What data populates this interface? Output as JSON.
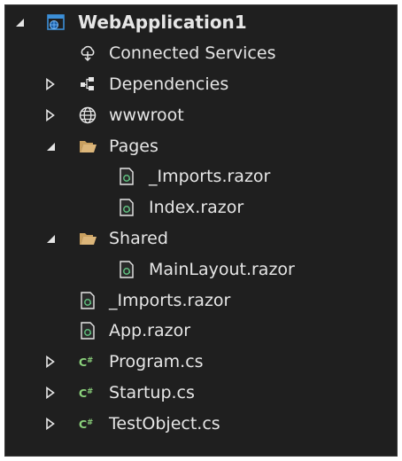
{
  "solution_explorer": {
    "root": {
      "label": "WebApplication1",
      "icon": "web-project-icon",
      "expanded": true
    },
    "items": [
      {
        "label": "Connected Services",
        "icon": "connected-services-icon"
      },
      {
        "label": "Dependencies",
        "icon": "dependencies-icon",
        "expanded": false
      },
      {
        "label": "wwwroot",
        "icon": "globe-icon",
        "expanded": false
      },
      {
        "label": "Pages",
        "icon": "folder-open-icon",
        "expanded": true,
        "children": [
          {
            "label": "_Imports.razor",
            "icon": "razor-file-icon"
          },
          {
            "label": "Index.razor",
            "icon": "razor-file-icon"
          }
        ]
      },
      {
        "label": "Shared",
        "icon": "folder-open-icon",
        "expanded": true,
        "children": [
          {
            "label": "MainLayout.razor",
            "icon": "razor-file-icon"
          }
        ]
      },
      {
        "label": "_Imports.razor",
        "icon": "razor-file-icon"
      },
      {
        "label": "App.razor",
        "icon": "razor-file-icon"
      },
      {
        "label": "Program.cs",
        "icon": "csharp-file-icon",
        "expanded": false
      },
      {
        "label": "Startup.cs",
        "icon": "csharp-file-icon",
        "expanded": false
      },
      {
        "label": "TestObject.cs",
        "icon": "csharp-file-icon",
        "expanded": false
      }
    ]
  },
  "colors": {
    "background": "#1f1f1f",
    "text": "#e6e6e6",
    "folder": "#dcb67a",
    "csharp": "#8bd17c",
    "razor_accent": "#5fbf7f",
    "project_blue": "#3c8fd8"
  }
}
